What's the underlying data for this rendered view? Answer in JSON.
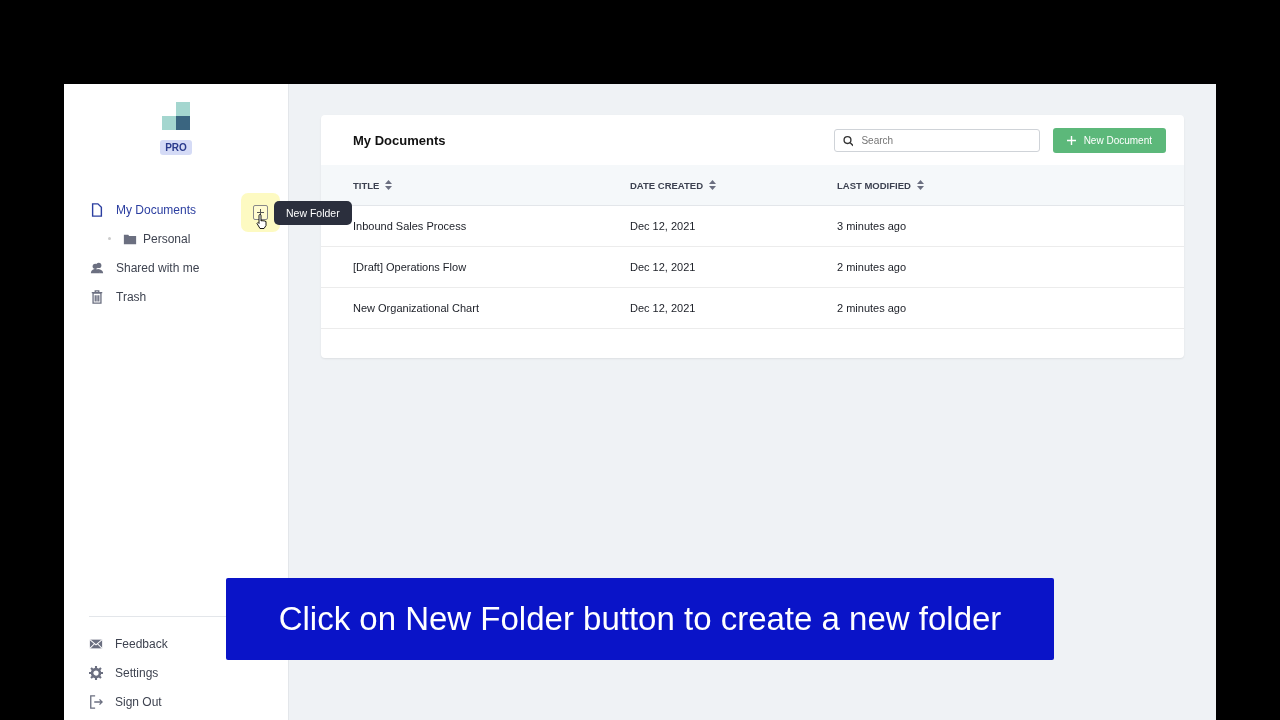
{
  "sidebar": {
    "badge": "PRO",
    "nav": [
      {
        "label": "My Documents",
        "selected": true,
        "children": [
          {
            "label": "Personal",
            "selected": false
          }
        ]
      },
      {
        "label": "Shared with me",
        "selected": false
      },
      {
        "label": "Trash",
        "selected": false
      }
    ],
    "tooltip": "New Folder",
    "bottom": [
      {
        "label": "Feedback"
      },
      {
        "label": "Settings"
      },
      {
        "label": "Sign Out"
      }
    ]
  },
  "main": {
    "title": "My Documents",
    "search": {
      "placeholder": "Search"
    },
    "new_button": "New Document",
    "table": {
      "columns": [
        "TITLE",
        "DATE CREATED",
        "LAST MODIFIED"
      ],
      "rows": [
        [
          "Inbound Sales Process",
          "Dec 12, 2021",
          "3 minutes ago"
        ],
        [
          "[Draft] Operations Flow",
          "Dec 12, 2021",
          "2 minutes ago"
        ],
        [
          "New Organizational Chart",
          "Dec 12, 2021",
          "2 minutes ago"
        ]
      ]
    }
  },
  "caption": "Click on New Folder button to create a new folder"
}
